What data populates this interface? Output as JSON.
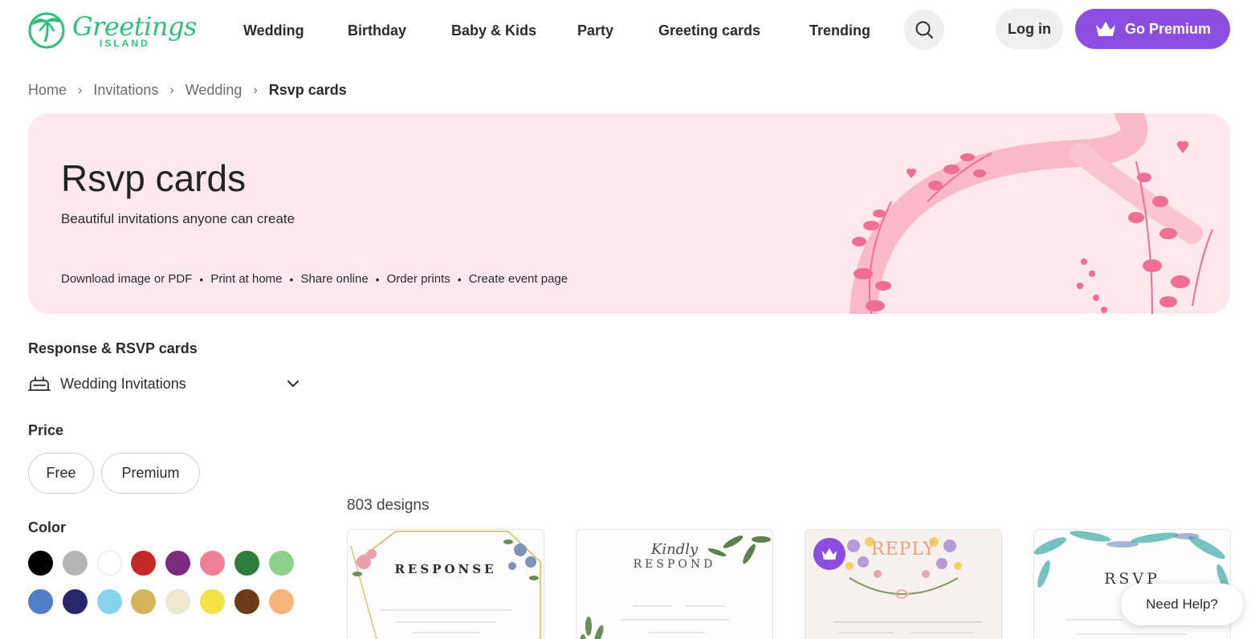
{
  "header": {
    "logo_word": "Greetings",
    "logo_sub": "ISLAND",
    "nav": [
      {
        "label": "Wedding"
      },
      {
        "label": "Birthday"
      },
      {
        "label": "Baby & Kids"
      },
      {
        "label": "Party"
      },
      {
        "label": "Greeting cards"
      },
      {
        "label": "Trending"
      }
    ],
    "login_label": "Log in",
    "premium_label": "Go Premium"
  },
  "breadcrumb": [
    "Home",
    "Invitations",
    "Wedding",
    "Rsvp cards"
  ],
  "hero": {
    "title": "Rsvp cards",
    "subtitle": "Beautiful invitations anyone can create",
    "features": [
      "Download image or PDF",
      "Print at home",
      "Share online",
      "Order prints",
      "Create event page"
    ]
  },
  "sidebar": {
    "section_title": "Response & RSVP cards",
    "category_select": "Wedding Invitations",
    "price_title": "Price",
    "price_options": [
      "Free",
      "Premium"
    ],
    "color_title": "Color",
    "colors": [
      "#000000",
      "#b5b5b5",
      "#ffffff",
      "#c62828",
      "#7b2c7f",
      "#ee7f97",
      "#2e7d3a",
      "#8ecf8a",
      "#4f7dc6",
      "#27276b",
      "#86d3ec",
      "#d4b35a",
      "#efe8cf",
      "#f2e246",
      "#6e3a17",
      "#f6b47b"
    ]
  },
  "results": {
    "count": "803 designs",
    "cards": [
      {
        "heading": "RESPONSE",
        "premium": false
      },
      {
        "heading": "RESPOND",
        "script": "Kindly",
        "premium": false
      },
      {
        "heading": "REPLY",
        "premium": true
      },
      {
        "heading": "RSVP",
        "premium": false
      }
    ]
  },
  "help_label": "Need Help?",
  "accent_color": "#8b4ee0",
  "brand_color": "#2fbf7a"
}
